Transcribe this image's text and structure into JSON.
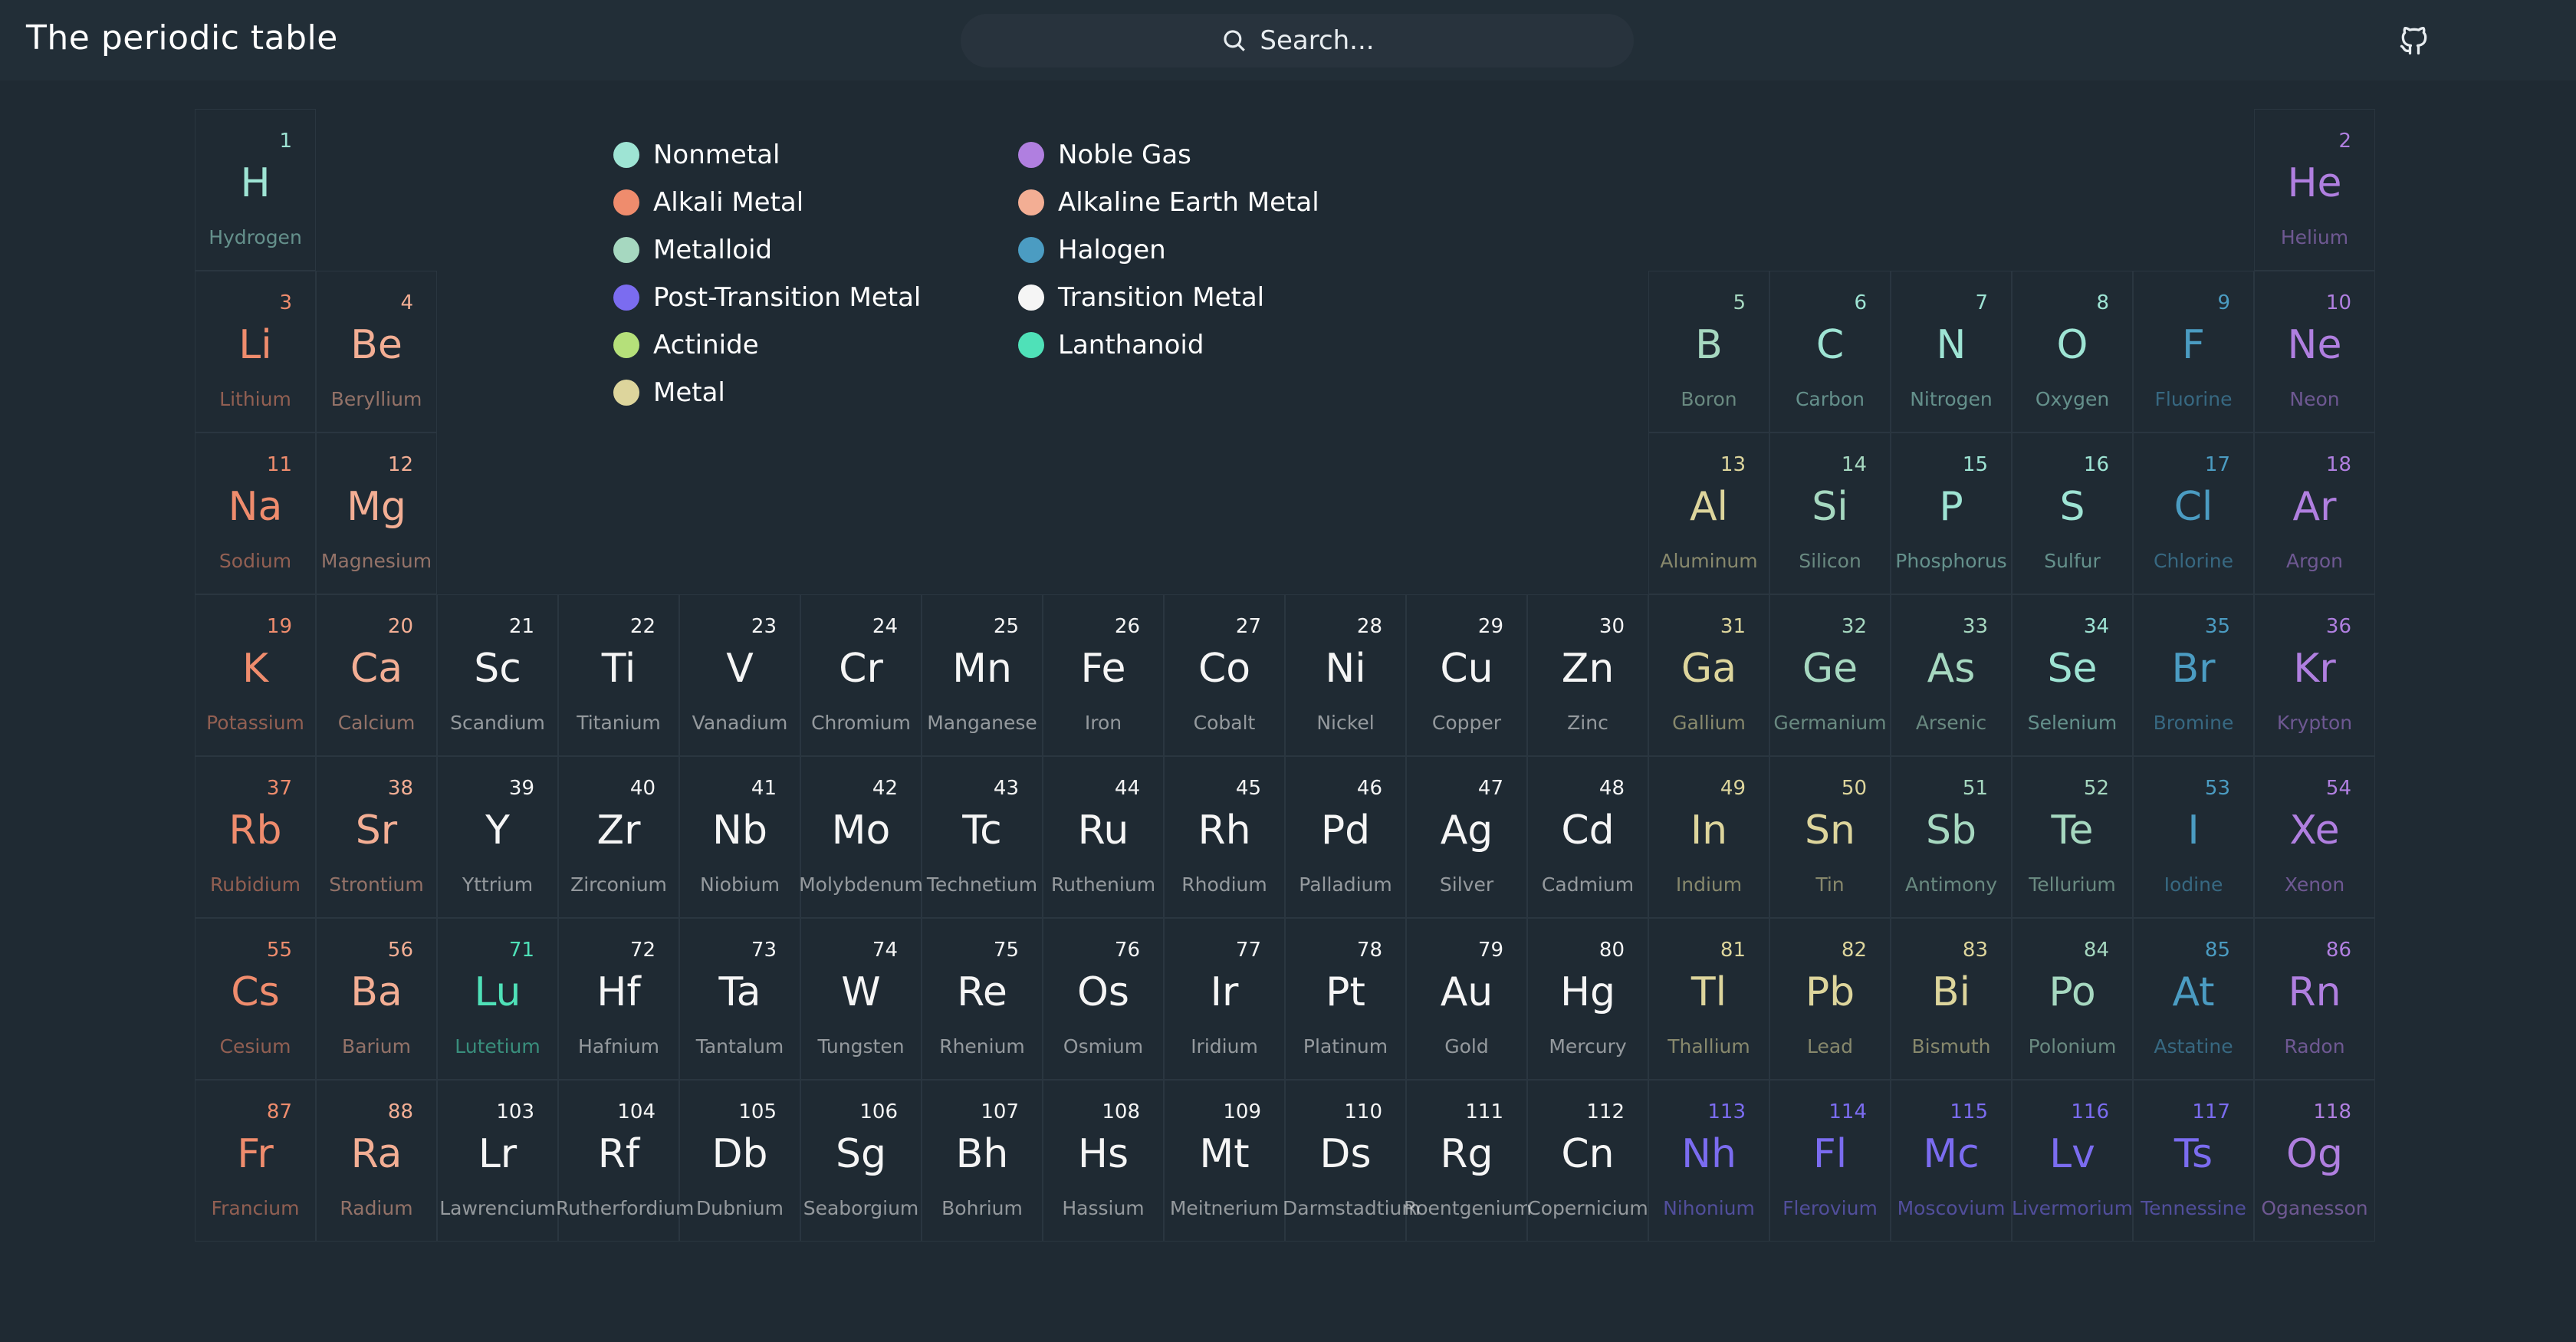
{
  "app": {
    "title": "The periodic table"
  },
  "search": {
    "placeholder": "Search..."
  },
  "header_icons": {
    "github": "github-icon",
    "search": "search-icon"
  },
  "categories": {
    "nonmetal": {
      "label": "Nonmetal",
      "color": "#9ee4d4"
    },
    "alkali": {
      "label": "Alkali Metal",
      "color": "#ef8c6d"
    },
    "metalloid": {
      "label": "Metalloid",
      "color": "#a6d8c0"
    },
    "post": {
      "label": "Post-Transition Metal",
      "color": "#7b6cf0"
    },
    "actinide": {
      "label": "Actinide",
      "color": "#b5e07a"
    },
    "metal": {
      "label": "Metal",
      "color": "#ddd59c"
    },
    "noble": {
      "label": "Noble Gas",
      "color": "#b07fe0"
    },
    "alkaline": {
      "label": "Alkaline Earth Metal",
      "color": "#f3ae94"
    },
    "halogen": {
      "label": "Halogen",
      "color": "#4b9cc2"
    },
    "transition": {
      "label": "Transition Metal",
      "color": "#f5f5f5"
    },
    "lanthanoid": {
      "label": "Lanthanoid",
      "color": "#4fe1b8"
    }
  },
  "legend": {
    "left": [
      "nonmetal",
      "alkali",
      "metalloid",
      "post",
      "actinide",
      "metal"
    ],
    "right": [
      "noble",
      "alkaline",
      "halogen",
      "transition",
      "lanthanoid"
    ]
  },
  "elements": [
    {
      "n": 1,
      "s": "H",
      "name": "Hydrogen",
      "c": "nonmetal",
      "row": 1,
      "col": 1
    },
    {
      "n": 2,
      "s": "He",
      "name": "Helium",
      "c": "noble",
      "row": 1,
      "col": 18
    },
    {
      "n": 3,
      "s": "Li",
      "name": "Lithium",
      "c": "alkali",
      "row": 2,
      "col": 1
    },
    {
      "n": 4,
      "s": "Be",
      "name": "Beryllium",
      "c": "alkaline",
      "row": 2,
      "col": 2
    },
    {
      "n": 5,
      "s": "B",
      "name": "Boron",
      "c": "metalloid",
      "row": 2,
      "col": 13
    },
    {
      "n": 6,
      "s": "C",
      "name": "Carbon",
      "c": "nonmetal",
      "row": 2,
      "col": 14
    },
    {
      "n": 7,
      "s": "N",
      "name": "Nitrogen",
      "c": "nonmetal",
      "row": 2,
      "col": 15
    },
    {
      "n": 8,
      "s": "O",
      "name": "Oxygen",
      "c": "nonmetal",
      "row": 2,
      "col": 16
    },
    {
      "n": 9,
      "s": "F",
      "name": "Fluorine",
      "c": "halogen",
      "row": 2,
      "col": 17
    },
    {
      "n": 10,
      "s": "Ne",
      "name": "Neon",
      "c": "noble",
      "row": 2,
      "col": 18
    },
    {
      "n": 11,
      "s": "Na",
      "name": "Sodium",
      "c": "alkali",
      "row": 3,
      "col": 1
    },
    {
      "n": 12,
      "s": "Mg",
      "name": "Magnesium",
      "c": "alkaline",
      "row": 3,
      "col": 2
    },
    {
      "n": 13,
      "s": "Al",
      "name": "Aluminum",
      "c": "metal",
      "row": 3,
      "col": 13
    },
    {
      "n": 14,
      "s": "Si",
      "name": "Silicon",
      "c": "metalloid",
      "row": 3,
      "col": 14
    },
    {
      "n": 15,
      "s": "P",
      "name": "Phosphorus",
      "c": "nonmetal",
      "row": 3,
      "col": 15
    },
    {
      "n": 16,
      "s": "S",
      "name": "Sulfur",
      "c": "nonmetal",
      "row": 3,
      "col": 16
    },
    {
      "n": 17,
      "s": "Cl",
      "name": "Chlorine",
      "c": "halogen",
      "row": 3,
      "col": 17
    },
    {
      "n": 18,
      "s": "Ar",
      "name": "Argon",
      "c": "noble",
      "row": 3,
      "col": 18
    },
    {
      "n": 19,
      "s": "K",
      "name": "Potassium",
      "c": "alkali",
      "row": 4,
      "col": 1
    },
    {
      "n": 20,
      "s": "Ca",
      "name": "Calcium",
      "c": "alkaline",
      "row": 4,
      "col": 2
    },
    {
      "n": 21,
      "s": "Sc",
      "name": "Scandium",
      "c": "transition",
      "row": 4,
      "col": 3
    },
    {
      "n": 22,
      "s": "Ti",
      "name": "Titanium",
      "c": "transition",
      "row": 4,
      "col": 4
    },
    {
      "n": 23,
      "s": "V",
      "name": "Vanadium",
      "c": "transition",
      "row": 4,
      "col": 5
    },
    {
      "n": 24,
      "s": "Cr",
      "name": "Chromium",
      "c": "transition",
      "row": 4,
      "col": 6
    },
    {
      "n": 25,
      "s": "Mn",
      "name": "Manganese",
      "c": "transition",
      "row": 4,
      "col": 7
    },
    {
      "n": 26,
      "s": "Fe",
      "name": "Iron",
      "c": "transition",
      "row": 4,
      "col": 8
    },
    {
      "n": 27,
      "s": "Co",
      "name": "Cobalt",
      "c": "transition",
      "row": 4,
      "col": 9
    },
    {
      "n": 28,
      "s": "Ni",
      "name": "Nickel",
      "c": "transition",
      "row": 4,
      "col": 10
    },
    {
      "n": 29,
      "s": "Cu",
      "name": "Copper",
      "c": "transition",
      "row": 4,
      "col": 11
    },
    {
      "n": 30,
      "s": "Zn",
      "name": "Zinc",
      "c": "transition",
      "row": 4,
      "col": 12
    },
    {
      "n": 31,
      "s": "Ga",
      "name": "Gallium",
      "c": "metal",
      "row": 4,
      "col": 13
    },
    {
      "n": 32,
      "s": "Ge",
      "name": "Germanium",
      "c": "metalloid",
      "row": 4,
      "col": 14
    },
    {
      "n": 33,
      "s": "As",
      "name": "Arsenic",
      "c": "metalloid",
      "row": 4,
      "col": 15
    },
    {
      "n": 34,
      "s": "Se",
      "name": "Selenium",
      "c": "nonmetal",
      "row": 4,
      "col": 16
    },
    {
      "n": 35,
      "s": "Br",
      "name": "Bromine",
      "c": "halogen",
      "row": 4,
      "col": 17
    },
    {
      "n": 36,
      "s": "Kr",
      "name": "Krypton",
      "c": "noble",
      "row": 4,
      "col": 18
    },
    {
      "n": 37,
      "s": "Rb",
      "name": "Rubidium",
      "c": "alkali",
      "row": 5,
      "col": 1
    },
    {
      "n": 38,
      "s": "Sr",
      "name": "Strontium",
      "c": "alkaline",
      "row": 5,
      "col": 2
    },
    {
      "n": 39,
      "s": "Y",
      "name": "Yttrium",
      "c": "transition",
      "row": 5,
      "col": 3
    },
    {
      "n": 40,
      "s": "Zr",
      "name": "Zirconium",
      "c": "transition",
      "row": 5,
      "col": 4
    },
    {
      "n": 41,
      "s": "Nb",
      "name": "Niobium",
      "c": "transition",
      "row": 5,
      "col": 5
    },
    {
      "n": 42,
      "s": "Mo",
      "name": "Molybdenum",
      "c": "transition",
      "row": 5,
      "col": 6
    },
    {
      "n": 43,
      "s": "Tc",
      "name": "Technetium",
      "c": "transition",
      "row": 5,
      "col": 7
    },
    {
      "n": 44,
      "s": "Ru",
      "name": "Ruthenium",
      "c": "transition",
      "row": 5,
      "col": 8
    },
    {
      "n": 45,
      "s": "Rh",
      "name": "Rhodium",
      "c": "transition",
      "row": 5,
      "col": 9
    },
    {
      "n": 46,
      "s": "Pd",
      "name": "Palladium",
      "c": "transition",
      "row": 5,
      "col": 10
    },
    {
      "n": 47,
      "s": "Ag",
      "name": "Silver",
      "c": "transition",
      "row": 5,
      "col": 11
    },
    {
      "n": 48,
      "s": "Cd",
      "name": "Cadmium",
      "c": "transition",
      "row": 5,
      "col": 12
    },
    {
      "n": 49,
      "s": "In",
      "name": "Indium",
      "c": "metal",
      "row": 5,
      "col": 13
    },
    {
      "n": 50,
      "s": "Sn",
      "name": "Tin",
      "c": "metal",
      "row": 5,
      "col": 14
    },
    {
      "n": 51,
      "s": "Sb",
      "name": "Antimony",
      "c": "metalloid",
      "row": 5,
      "col": 15
    },
    {
      "n": 52,
      "s": "Te",
      "name": "Tellurium",
      "c": "metalloid",
      "row": 5,
      "col": 16
    },
    {
      "n": 53,
      "s": "I",
      "name": "Iodine",
      "c": "halogen",
      "row": 5,
      "col": 17
    },
    {
      "n": 54,
      "s": "Xe",
      "name": "Xenon",
      "c": "noble",
      "row": 5,
      "col": 18
    },
    {
      "n": 55,
      "s": "Cs",
      "name": "Cesium",
      "c": "alkali",
      "row": 6,
      "col": 1
    },
    {
      "n": 56,
      "s": "Ba",
      "name": "Barium",
      "c": "alkaline",
      "row": 6,
      "col": 2
    },
    {
      "n": 71,
      "s": "Lu",
      "name": "Lutetium",
      "c": "lanthanoid",
      "row": 6,
      "col": 3
    },
    {
      "n": 72,
      "s": "Hf",
      "name": "Hafnium",
      "c": "transition",
      "row": 6,
      "col": 4
    },
    {
      "n": 73,
      "s": "Ta",
      "name": "Tantalum",
      "c": "transition",
      "row": 6,
      "col": 5
    },
    {
      "n": 74,
      "s": "W",
      "name": "Tungsten",
      "c": "transition",
      "row": 6,
      "col": 6
    },
    {
      "n": 75,
      "s": "Re",
      "name": "Rhenium",
      "c": "transition",
      "row": 6,
      "col": 7
    },
    {
      "n": 76,
      "s": "Os",
      "name": "Osmium",
      "c": "transition",
      "row": 6,
      "col": 8
    },
    {
      "n": 77,
      "s": "Ir",
      "name": "Iridium",
      "c": "transition",
      "row": 6,
      "col": 9
    },
    {
      "n": 78,
      "s": "Pt",
      "name": "Platinum",
      "c": "transition",
      "row": 6,
      "col": 10
    },
    {
      "n": 79,
      "s": "Au",
      "name": "Gold",
      "c": "transition",
      "row": 6,
      "col": 11
    },
    {
      "n": 80,
      "s": "Hg",
      "name": "Mercury",
      "c": "transition",
      "row": 6,
      "col": 12
    },
    {
      "n": 81,
      "s": "Tl",
      "name": "Thallium",
      "c": "metal",
      "row": 6,
      "col": 13
    },
    {
      "n": 82,
      "s": "Pb",
      "name": "Lead",
      "c": "metal",
      "row": 6,
      "col": 14
    },
    {
      "n": 83,
      "s": "Bi",
      "name": "Bismuth",
      "c": "metal",
      "row": 6,
      "col": 15
    },
    {
      "n": 84,
      "s": "Po",
      "name": "Polonium",
      "c": "metalloid",
      "row": 6,
      "col": 16
    },
    {
      "n": 85,
      "s": "At",
      "name": "Astatine",
      "c": "halogen",
      "row": 6,
      "col": 17
    },
    {
      "n": 86,
      "s": "Rn",
      "name": "Radon",
      "c": "noble",
      "row": 6,
      "col": 18
    },
    {
      "n": 87,
      "s": "Fr",
      "name": "Francium",
      "c": "alkali",
      "row": 7,
      "col": 1
    },
    {
      "n": 88,
      "s": "Ra",
      "name": "Radium",
      "c": "alkaline",
      "row": 7,
      "col": 2
    },
    {
      "n": 103,
      "s": "Lr",
      "name": "Lawrencium",
      "c": "transition",
      "row": 7,
      "col": 3
    },
    {
      "n": 104,
      "s": "Rf",
      "name": "Rutherfordium",
      "c": "transition",
      "row": 7,
      "col": 4
    },
    {
      "n": 105,
      "s": "Db",
      "name": "Dubnium",
      "c": "transition",
      "row": 7,
      "col": 5
    },
    {
      "n": 106,
      "s": "Sg",
      "name": "Seaborgium",
      "c": "transition",
      "row": 7,
      "col": 6
    },
    {
      "n": 107,
      "s": "Bh",
      "name": "Bohrium",
      "c": "transition",
      "row": 7,
      "col": 7
    },
    {
      "n": 108,
      "s": "Hs",
      "name": "Hassium",
      "c": "transition",
      "row": 7,
      "col": 8
    },
    {
      "n": 109,
      "s": "Mt",
      "name": "Meitnerium",
      "c": "transition",
      "row": 7,
      "col": 9
    },
    {
      "n": 110,
      "s": "Ds",
      "name": "Darmstadtium",
      "c": "transition",
      "row": 7,
      "col": 10
    },
    {
      "n": 111,
      "s": "Rg",
      "name": "Roentgenium",
      "c": "transition",
      "row": 7,
      "col": 11
    },
    {
      "n": 112,
      "s": "Cn",
      "name": "Copernicium",
      "c": "transition",
      "row": 7,
      "col": 12
    },
    {
      "n": 113,
      "s": "Nh",
      "name": "Nihonium",
      "c": "post",
      "row": 7,
      "col": 13
    },
    {
      "n": 114,
      "s": "Fl",
      "name": "Flerovium",
      "c": "post",
      "row": 7,
      "col": 14
    },
    {
      "n": 115,
      "s": "Mc",
      "name": "Moscovium",
      "c": "post",
      "row": 7,
      "col": 15
    },
    {
      "n": 116,
      "s": "Lv",
      "name": "Livermorium",
      "c": "post",
      "row": 7,
      "col": 16
    },
    {
      "n": 117,
      "s": "Ts",
      "name": "Tennessine",
      "c": "post",
      "row": 7,
      "col": 17
    },
    {
      "n": 118,
      "s": "Og",
      "name": "Oganesson",
      "c": "noble",
      "row": 7,
      "col": 18
    }
  ]
}
